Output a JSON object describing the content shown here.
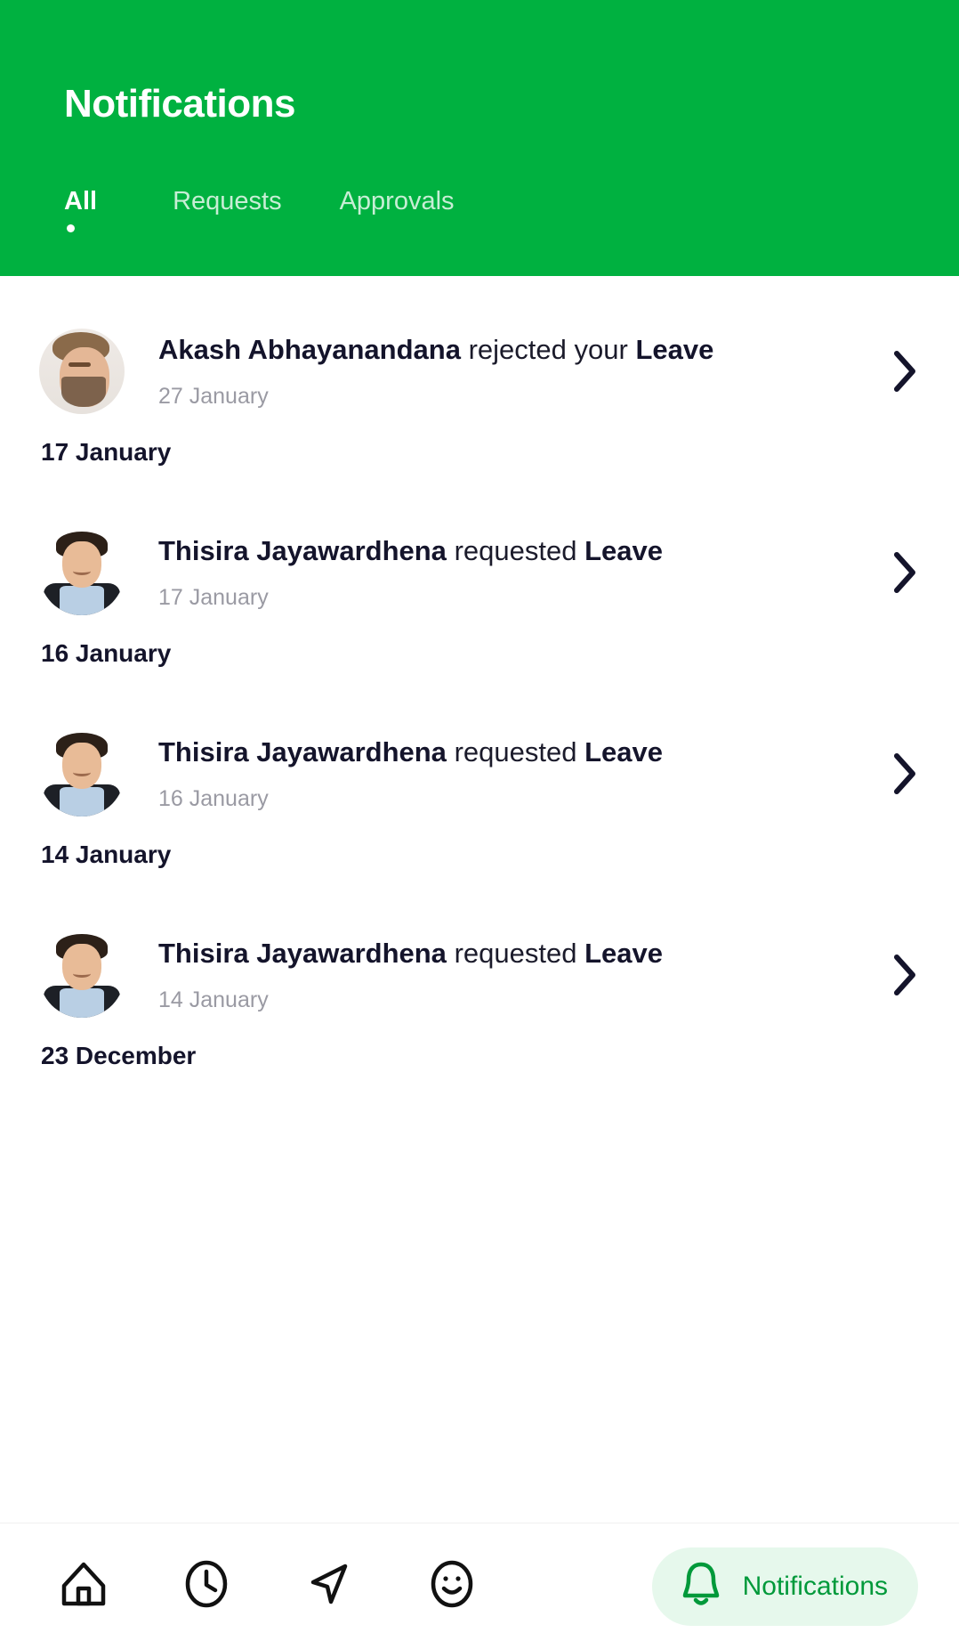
{
  "header": {
    "title": "Notifications",
    "background_color": "#00b140",
    "tabs": [
      {
        "label": "All",
        "active": true
      },
      {
        "label": "Requests",
        "active": false
      },
      {
        "label": "Approvals",
        "active": false
      }
    ]
  },
  "list": {
    "items": [
      {
        "type": "notification",
        "actor": "Akash Abhayanandana",
        "action": "rejected your",
        "subject": "Leave",
        "date": "27 January",
        "avatar": "male-beard-photo"
      },
      {
        "type": "date_header",
        "label": "17 January"
      },
      {
        "type": "notification",
        "actor": "Thisira Jayawardhena",
        "action": "requested",
        "subject": "Leave",
        "date": "17 January",
        "avatar": "male-suit-photo"
      },
      {
        "type": "date_header",
        "label": "16 January"
      },
      {
        "type": "notification",
        "actor": "Thisira Jayawardhena",
        "action": "requested",
        "subject": "Leave",
        "date": "16 January",
        "avatar": "male-suit-photo"
      },
      {
        "type": "date_header",
        "label": "14 January"
      },
      {
        "type": "notification",
        "actor": "Thisira Jayawardhena",
        "action": "requested",
        "subject": "Leave",
        "date": "14 January",
        "avatar": "male-suit-photo"
      },
      {
        "type": "date_header",
        "label": "23 December"
      }
    ]
  },
  "bottom_nav": {
    "items": [
      {
        "icon": "home-icon",
        "label": "",
        "active": false
      },
      {
        "icon": "clock-icon",
        "label": "",
        "active": false
      },
      {
        "icon": "send-icon",
        "label": "",
        "active": false
      },
      {
        "icon": "smiley-icon",
        "label": "",
        "active": false
      }
    ],
    "active_item": {
      "icon": "bell-icon",
      "label": "Notifications",
      "active": true
    },
    "active_color": "#00993a",
    "active_pill_color": "#e6f8ec"
  }
}
